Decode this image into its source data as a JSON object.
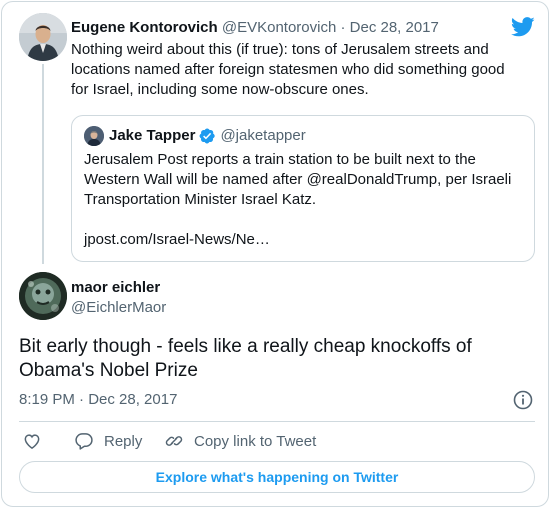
{
  "parent_tweet": {
    "author_name": "Eugene Kontorovich",
    "handle_date": "@EVKontorovich · Dec 28, 2017",
    "text": "Nothing weird about this (if true): tons of Jerusalem streets and locations named after foreign statesmen who did something good for Israel, including some now-obscure ones."
  },
  "quoted_tweet": {
    "author_name": "Jake Tapper",
    "handle": "@jaketapper",
    "text": "Jerusalem Post reports a train station to be built next to the Western Wall will be named after @realDonaldTrump, per Israeli Transportation Minister Israel Katz.",
    "link": "jpost.com/Israel-News/Ne…"
  },
  "main_tweet": {
    "author_name": "maor eichler",
    "handle": "@EichlerMaor",
    "text": "Bit early though - feels like a really cheap knockoffs of Obama's Nobel Prize",
    "timestamp": "8:19 PM · Dec 28, 2017"
  },
  "actions": {
    "reply_label": "Reply",
    "copy_label": "Copy link to Tweet"
  },
  "explore_label": "Explore what's happening on Twitter",
  "icons": {
    "brand": "twitter-bird-icon",
    "verified": "verified-badge-icon",
    "info": "info-icon",
    "like": "heart-icon",
    "reply": "reply-icon",
    "copy": "link-icon"
  },
  "colors": {
    "accent": "#1d9bf0",
    "text": "#0f1419",
    "secondary": "#536471",
    "border": "#cfd9de"
  }
}
